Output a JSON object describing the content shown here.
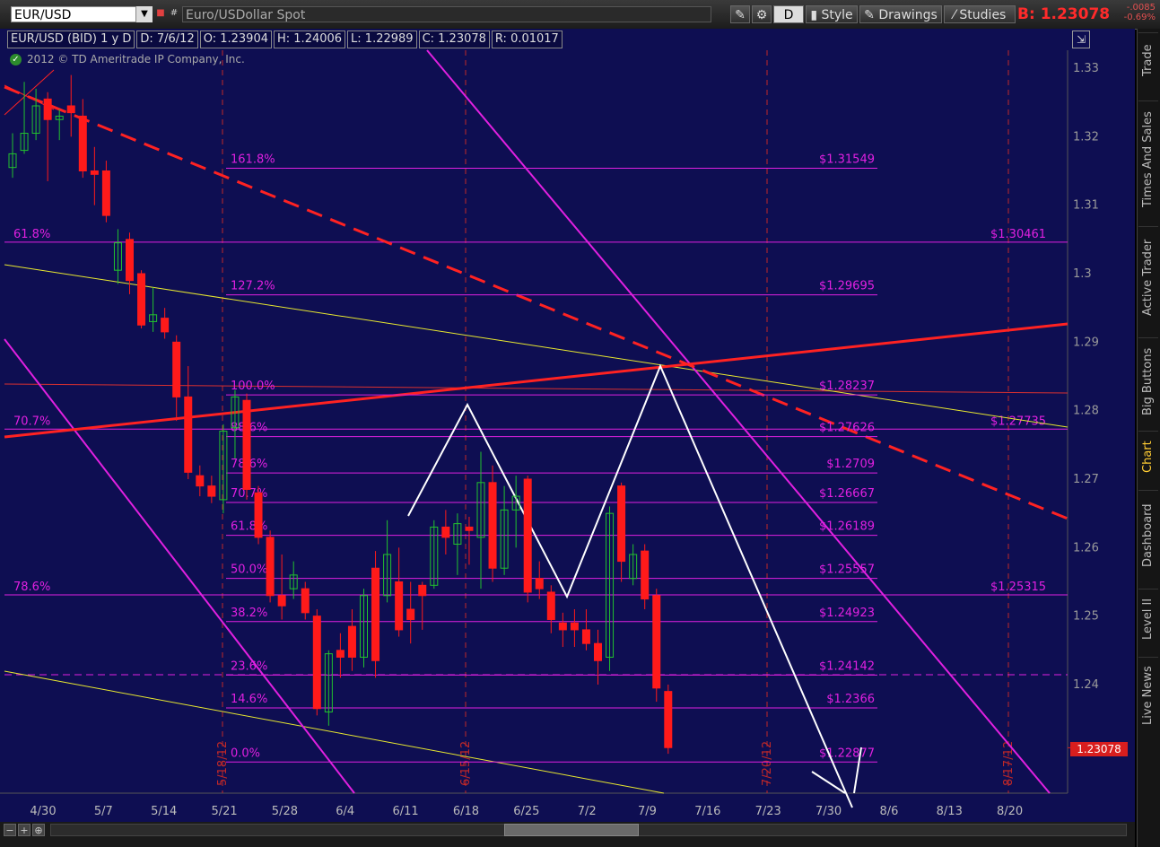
{
  "topbar": {
    "symbol": "EUR/USD",
    "description": "Euro/USDollar Spot",
    "timeframe_button": "D",
    "style_label": "Style",
    "drawings_label": "Drawings",
    "studies_label": "Studies",
    "bid_label": "B:",
    "bid_value": "1.23078",
    "change_abs": "-.0085",
    "change_pct": "-0.69%"
  },
  "info": {
    "symbol_period": "EUR/USD (BID) 1 y D",
    "date": "D: 7/6/12",
    "open": "O: 1.23904",
    "high": "H: 1.24006",
    "low": "L: 1.22989",
    "close": "C: 1.23078",
    "range": "R: 0.01017",
    "copyright": "2012 © TD Ameritrade IP Company, Inc."
  },
  "side_tabs": [
    "Trade",
    "Times And Sales",
    "Active Trader",
    "Big Buttons",
    "Chart",
    "Dashboard",
    "Level II",
    "Live News"
  ],
  "colors": {
    "background": "#0e0e52",
    "up_candle": "#22c22e",
    "down_candle": "#ff1a1a",
    "fib": "#e020e0",
    "trend_red": "#ff2222",
    "trend_yellow": "#e8e830",
    "pattern": "#ffffff",
    "last_price": "#d81e1e"
  },
  "chart_data": {
    "type": "candlestick",
    "title": "EUR/USD (BID) 1 y D",
    "ylim": [
      1.218,
      1.336
    ],
    "y_ticks": [
      "1.33",
      "1.32",
      "1.31",
      "1.3",
      "1.29",
      "1.28",
      "1.27",
      "1.26",
      "1.25",
      "1.24"
    ],
    "x_labels": [
      "4/30",
      "5/7",
      "5/14",
      "5/21",
      "5/28",
      "6/4",
      "6/11",
      "6/18",
      "6/25",
      "7/2",
      "7/9",
      "7/16",
      "7/23",
      "7/30",
      "8/6",
      "8/13",
      "8/20"
    ],
    "last_price": "1.23078",
    "event_markers": [
      "5/18/12",
      "6/15/12",
      "7/20/12",
      "8/17/12"
    ],
    "candles": [
      {
        "o": 1.3155,
        "h": 1.3205,
        "l": 1.314,
        "c": 1.3175
      },
      {
        "o": 1.318,
        "h": 1.328,
        "l": 1.3175,
        "c": 1.3205
      },
      {
        "o": 1.3205,
        "h": 1.327,
        "l": 1.3195,
        "c": 1.3245
      },
      {
        "o": 1.3255,
        "h": 1.3265,
        "l": 1.3135,
        "c": 1.3225
      },
      {
        "o": 1.3225,
        "h": 1.324,
        "l": 1.3195,
        "c": 1.323
      },
      {
        "o": 1.3245,
        "h": 1.329,
        "l": 1.32,
        "c": 1.3235
      },
      {
        "o": 1.323,
        "h": 1.3255,
        "l": 1.314,
        "c": 1.315
      },
      {
        "o": 1.315,
        "h": 1.3185,
        "l": 1.31,
        "c": 1.3145
      },
      {
        "o": 1.315,
        "h": 1.3165,
        "l": 1.3075,
        "c": 1.3085
      },
      {
        "o": 1.3005,
        "h": 1.3065,
        "l": 1.2985,
        "c": 1.3045
      },
      {
        "o": 1.305,
        "h": 1.306,
        "l": 1.297,
        "c": 1.299
      },
      {
        "o": 1.3,
        "h": 1.3005,
        "l": 1.292,
        "c": 1.2925
      },
      {
        "o": 1.293,
        "h": 1.298,
        "l": 1.2915,
        "c": 1.294
      },
      {
        "o": 1.2935,
        "h": 1.295,
        "l": 1.2905,
        "c": 1.2915
      },
      {
        "o": 1.29,
        "h": 1.291,
        "l": 1.2785,
        "c": 1.282
      },
      {
        "o": 1.282,
        "h": 1.2865,
        "l": 1.27,
        "c": 1.271
      },
      {
        "o": 1.2705,
        "h": 1.272,
        "l": 1.2675,
        "c": 1.269
      },
      {
        "o": 1.269,
        "h": 1.2705,
        "l": 1.2665,
        "c": 1.2675
      },
      {
        "o": 1.267,
        "h": 1.278,
        "l": 1.265,
        "c": 1.277
      },
      {
        "o": 1.2775,
        "h": 1.283,
        "l": 1.273,
        "c": 1.282
      },
      {
        "o": 1.2815,
        "h": 1.2825,
        "l": 1.267,
        "c": 1.2685
      },
      {
        "o": 1.268,
        "h": 1.269,
        "l": 1.2605,
        "c": 1.2615
      },
      {
        "o": 1.2615,
        "h": 1.2625,
        "l": 1.252,
        "c": 1.253
      },
      {
        "o": 1.253,
        "h": 1.259,
        "l": 1.2495,
        "c": 1.2515
      },
      {
        "o": 1.254,
        "h": 1.258,
        "l": 1.2525,
        "c": 1.256
      },
      {
        "o": 1.254,
        "h": 1.255,
        "l": 1.2495,
        "c": 1.2505
      },
      {
        "o": 1.25,
        "h": 1.251,
        "l": 1.2355,
        "c": 1.2365
      },
      {
        "o": 1.236,
        "h": 1.245,
        "l": 1.234,
        "c": 1.2445
      },
      {
        "o": 1.245,
        "h": 1.2475,
        "l": 1.241,
        "c": 1.244
      },
      {
        "o": 1.2485,
        "h": 1.251,
        "l": 1.242,
        "c": 1.244
      },
      {
        "o": 1.244,
        "h": 1.254,
        "l": 1.2425,
        "c": 1.253
      },
      {
        "o": 1.257,
        "h": 1.2595,
        "l": 1.241,
        "c": 1.2435
      },
      {
        "o": 1.253,
        "h": 1.264,
        "l": 1.252,
        "c": 1.259
      },
      {
        "o": 1.255,
        "h": 1.26,
        "l": 1.247,
        "c": 1.248
      },
      {
        "o": 1.251,
        "h": 1.255,
        "l": 1.246,
        "c": 1.2495
      },
      {
        "o": 1.2545,
        "h": 1.255,
        "l": 1.248,
        "c": 1.253
      },
      {
        "o": 1.2545,
        "h": 1.264,
        "l": 1.254,
        "c": 1.263
      },
      {
        "o": 1.263,
        "h": 1.2655,
        "l": 1.259,
        "c": 1.2615
      },
      {
        "o": 1.2605,
        "h": 1.265,
        "l": 1.256,
        "c": 1.2635
      },
      {
        "o": 1.263,
        "h": 1.2645,
        "l": 1.2575,
        "c": 1.2625
      },
      {
        "o": 1.2615,
        "h": 1.274,
        "l": 1.254,
        "c": 1.2695
      },
      {
        "o": 1.2695,
        "h": 1.272,
        "l": 1.255,
        "c": 1.257
      },
      {
        "o": 1.257,
        "h": 1.269,
        "l": 1.256,
        "c": 1.2655
      },
      {
        "o": 1.2655,
        "h": 1.2705,
        "l": 1.26,
        "c": 1.2675
      },
      {
        "o": 1.27,
        "h": 1.2705,
        "l": 1.252,
        "c": 1.2535
      },
      {
        "o": 1.2555,
        "h": 1.258,
        "l": 1.2525,
        "c": 1.254
      },
      {
        "o": 1.2535,
        "h": 1.2545,
        "l": 1.2475,
        "c": 1.2495
      },
      {
        "o": 1.249,
        "h": 1.2505,
        "l": 1.2455,
        "c": 1.248
      },
      {
        "o": 1.249,
        "h": 1.251,
        "l": 1.2455,
        "c": 1.248
      },
      {
        "o": 1.248,
        "h": 1.251,
        "l": 1.245,
        "c": 1.246
      },
      {
        "o": 1.246,
        "h": 1.248,
        "l": 1.24,
        "c": 1.2435
      },
      {
        "o": 1.244,
        "h": 1.266,
        "l": 1.242,
        "c": 1.265
      },
      {
        "o": 1.269,
        "h": 1.2695,
        "l": 1.255,
        "c": 1.258
      },
      {
        "o": 1.2555,
        "h": 1.2605,
        "l": 1.2545,
        "c": 1.259
      },
      {
        "o": 1.2595,
        "h": 1.2605,
        "l": 1.251,
        "c": 1.2525
      },
      {
        "o": 1.253,
        "h": 1.254,
        "l": 1.2375,
        "c": 1.2395
      },
      {
        "o": 1.239,
        "h": 1.24,
        "l": 1.2299,
        "c": 1.2308
      }
    ],
    "fib_levels": [
      {
        "label": "161.8%",
        "value": 1.3154,
        "text": "$1.31549"
      },
      {
        "label": "127.2%",
        "value": 1.2969,
        "text": "$1.29695"
      },
      {
        "label": "100.0%",
        "value": 1.2823,
        "text": "$1.28237"
      },
      {
        "label": "88.6%",
        "value": 1.2762,
        "text": "$1.27626"
      },
      {
        "label": "78.6%",
        "value": 1.2709,
        "text": "$1.2709"
      },
      {
        "label": "70.7%",
        "value": 1.2666,
        "text": "$1.26667"
      },
      {
        "label": "61.8%",
        "value": 1.2618,
        "text": "$1.26189"
      },
      {
        "label": "50.0%",
        "value": 1.2555,
        "text": "$1.25557"
      },
      {
        "label": "38.2%",
        "value": 1.2492,
        "text": "$1.24923"
      },
      {
        "label": "23.6%",
        "value": 1.2414,
        "text": "$1.24142"
      },
      {
        "label": "14.6%",
        "value": 1.2366,
        "text": "$1.2366"
      },
      {
        "label": "0.0%",
        "value": 1.2287,
        "text": "$1.22877"
      }
    ],
    "fib_levels_long": [
      {
        "label": "61.8%",
        "value": 1.3046,
        "text": "$1.30461"
      },
      {
        "label": "70.7%",
        "value": 1.2773,
        "text": "$1.27735"
      },
      {
        "label": "78.6%",
        "value": 1.2531,
        "text": "$1.25315"
      }
    ]
  }
}
